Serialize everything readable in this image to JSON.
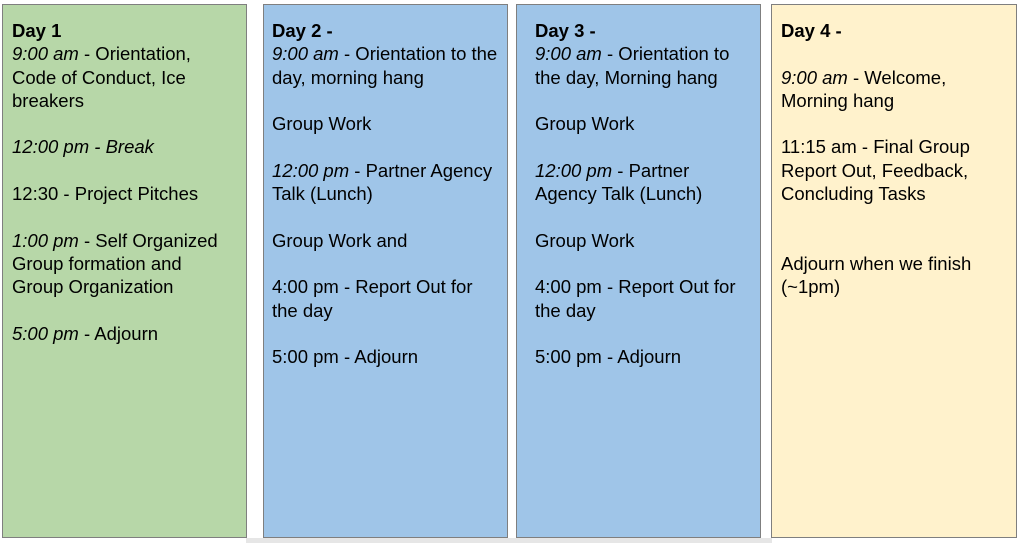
{
  "colors": {
    "day1_bg": "#b7d7a8",
    "day2_bg": "#9fc5e8",
    "day3_bg": "#9fc5e8",
    "day4_bg": "#fff2cc",
    "border": "#7f7f7f"
  },
  "day1": {
    "title": "Day 1",
    "e1_time": "9:00 am",
    "e1_text": " - Orientation, Code of Conduct, Ice breakers",
    "e2_time": "12:00 pm - Break",
    "e3_text": "12:30 - Project Pitches",
    "e4_time": "1:00 pm",
    "e4_text": " - Self Organized Group formation and Group Organization",
    "e5_time": "5:00 pm",
    "e5_text": " - Adjourn"
  },
  "day2": {
    "title": "Day 2 -",
    "e1_time": "9:00 am",
    "e1_text": " - Orientation to the day, morning hang",
    "e2_text": "Group Work",
    "e3_time": "12:00 pm",
    "e3_text": " - Partner Agency Talk (Lunch)",
    "e4_text": "Group Work and",
    "e5_text": "4:00 pm - Report Out for the day",
    "e6_text": "5:00 pm - Adjourn"
  },
  "day3": {
    "title": "Day 3 -",
    "e1_time": "9:00 am",
    "e1_text": " - Orientation to the day, Morning hang",
    "e2_text": "Group Work",
    "e3_time": "12:00 pm",
    "e3_text": " - Partner Agency Talk (Lunch)",
    "e4_text": "Group Work",
    "e5_text": "4:00 pm - Report Out for the day",
    "e6_text": "5:00 pm - Adjourn"
  },
  "day4": {
    "title": "Day 4 -",
    "e1_time": "9:00 am",
    "e1_text": " - Welcome, Morning hang",
    "e2_text": "11:15 am - Final Group Report Out, Feedback, Concluding Tasks",
    "e3_text": "Adjourn when we finish (~1pm)"
  }
}
